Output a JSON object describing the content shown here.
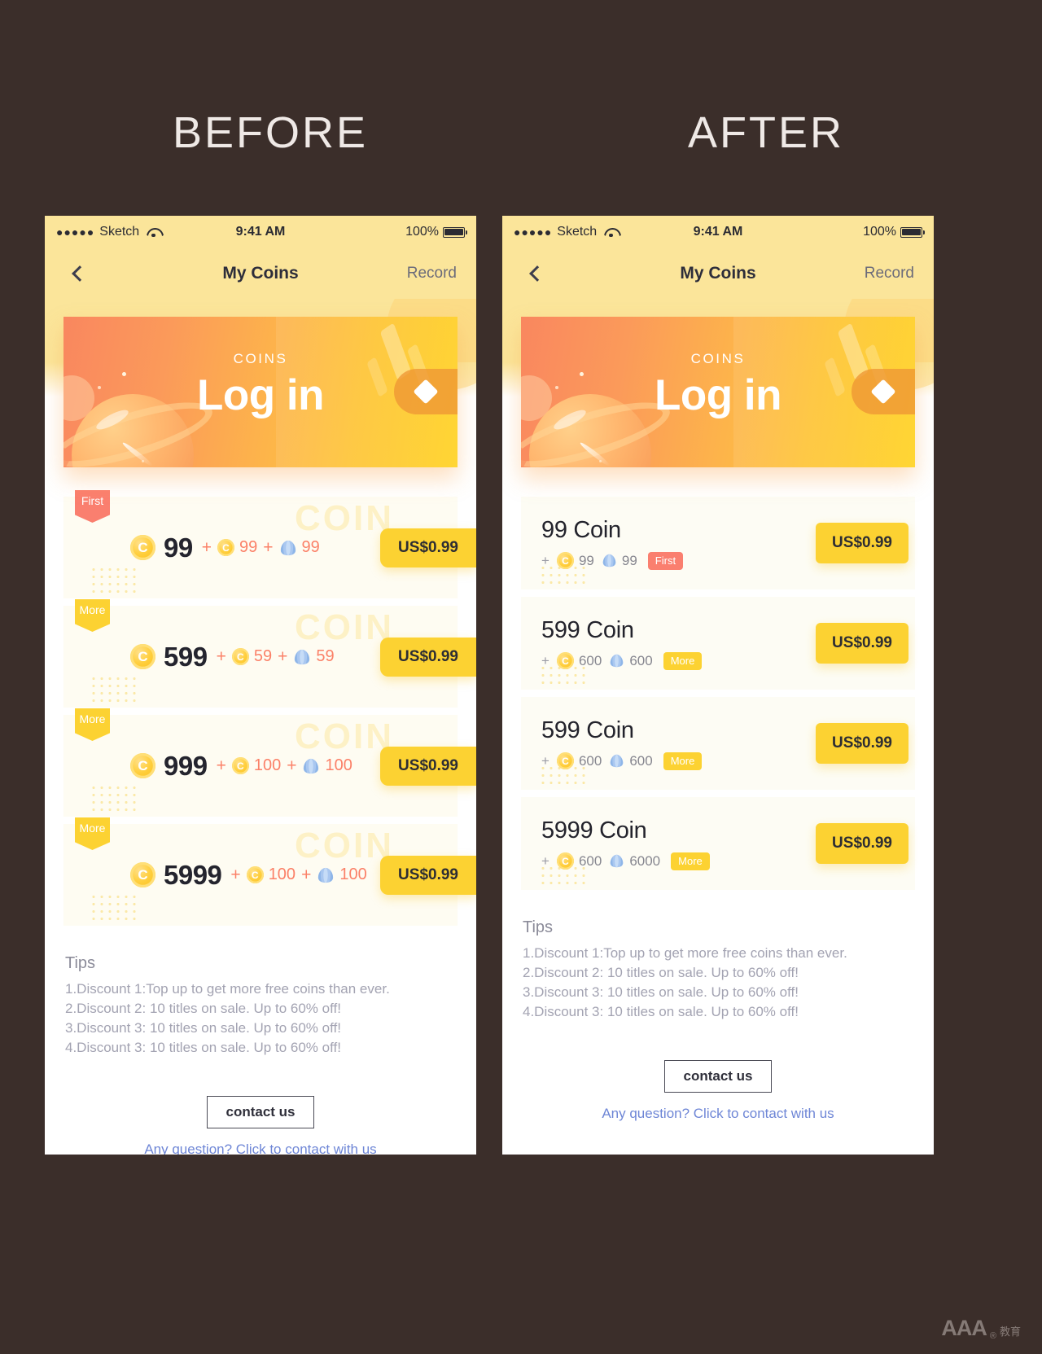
{
  "headings": {
    "before": "BEFORE",
    "after": "AFTER"
  },
  "status_bar": {
    "dots": "●●●●●",
    "carrier": "Sketch",
    "wifi_icon": "wifi-icon",
    "time": "9:41 AM",
    "battery_percent": "100%",
    "battery_icon": "battery-full-icon"
  },
  "nav": {
    "back_icon": "chevron-left-icon",
    "title": "My Coins",
    "action": "Record"
  },
  "hero": {
    "eyebrow": "COINS",
    "title": "Log in",
    "tab_icon": "diamond-icon"
  },
  "before": {
    "watermark": "COIN",
    "rows": [
      {
        "badge": "First",
        "badge_color": "#fa7f6f",
        "coin_icon": "coin-icon",
        "amount": "99",
        "plus": "+",
        "bonus_coin_icon": "coin-icon",
        "bonus_coin": "99",
        "bonus_shell_icon": "shell-icon",
        "bonus_shell": "99",
        "price": "US$0.99"
      },
      {
        "badge": "More",
        "badge_color": "#fcd232",
        "coin_icon": "coin-icon",
        "amount": "599",
        "plus": "+",
        "bonus_coin_icon": "coin-icon",
        "bonus_coin": "59",
        "bonus_shell_icon": "shell-icon",
        "bonus_shell": "59",
        "price": "US$0.99"
      },
      {
        "badge": "More",
        "badge_color": "#fcd232",
        "coin_icon": "coin-icon",
        "amount": "999",
        "plus": "+",
        "bonus_coin_icon": "coin-icon",
        "bonus_coin": "100",
        "bonus_shell_icon": "shell-icon",
        "bonus_shell": "100",
        "price": "US$0.99"
      },
      {
        "badge": "More",
        "badge_color": "#fcd232",
        "coin_icon": "coin-icon",
        "amount": "5999",
        "plus": "+",
        "bonus_coin_icon": "coin-icon",
        "bonus_coin": "100",
        "bonus_shell_icon": "shell-icon",
        "bonus_shell": "100",
        "price": "US$0.99"
      }
    ]
  },
  "after": {
    "cards": [
      {
        "title": "99 Coin",
        "plus": "+",
        "coin_icon": "coin-icon",
        "coin_bonus": "99",
        "shell_icon": "shell-icon",
        "shell_bonus": "99",
        "badge": "First",
        "badge_color": "#fa7f6f",
        "price": "US$0.99"
      },
      {
        "title": "599 Coin",
        "plus": "+",
        "coin_icon": "coin-icon",
        "coin_bonus": "600",
        "shell_icon": "shell-icon",
        "shell_bonus": "600",
        "badge": "More",
        "badge_color": "#fcd232",
        "price": "US$0.99"
      },
      {
        "title": "599 Coin",
        "plus": "+",
        "coin_icon": "coin-icon",
        "coin_bonus": "600",
        "shell_icon": "shell-icon",
        "shell_bonus": "600",
        "badge": "More",
        "badge_color": "#fcd232",
        "price": "US$0.99"
      },
      {
        "title": "5999 Coin",
        "plus": "+",
        "coin_icon": "coin-icon",
        "coin_bonus": "600",
        "shell_icon": "shell-icon",
        "shell_bonus": "6000",
        "badge": "More",
        "badge_color": "#fcd232",
        "price": "US$0.99"
      }
    ]
  },
  "tips": {
    "title": "Tips",
    "lines": [
      "1.Discount 1:Top up to get more free coins than ever.",
      "2.Discount 2: 10 titles on sale. Up to 60% off!",
      "3.Discount 3: 10 titles on sale. Up to 60% off!",
      "4.Discount 3: 10 titles on sale. Up to 60% off!"
    ]
  },
  "footer": {
    "button": "contact us",
    "link": "Any question? Click to contact with us"
  },
  "watermark": {
    "text": "AAA",
    "sup": "®",
    "cn": "教育"
  },
  "colors": {
    "page_bg": "#3b2e2a",
    "status_bg": "#fbe59a",
    "accent_yellow": "#fcd232",
    "accent_red": "#fa7f6f",
    "hero_from": "#f9875f",
    "hero_to": "#ffd634"
  }
}
